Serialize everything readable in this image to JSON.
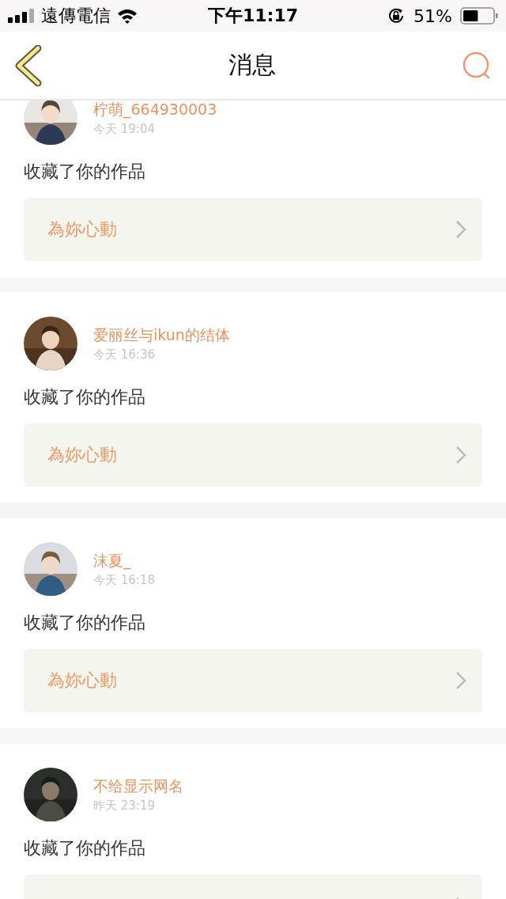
{
  "status_bar": {
    "carrier": "遠傳電信",
    "time": "下午11:17",
    "battery": "51%"
  },
  "nav": {
    "title": "消息"
  },
  "notifications": [
    {
      "user": "柠萌_664930003",
      "time": "今天 19:04",
      "action": "收藏了你的作品",
      "work": "為妳心動"
    },
    {
      "user": "爱丽丝与ikun的结体",
      "time": "今天 16:36",
      "action": "收藏了你的作品",
      "work": "為妳心動"
    },
    {
      "user": "沫夏_",
      "time": "今天 16:18",
      "action": "收藏了你的作品",
      "work": "為妳心動"
    },
    {
      "user": "不给显示网名",
      "time": "昨天 23:19",
      "action": "收藏了你的作品"
    }
  ]
}
